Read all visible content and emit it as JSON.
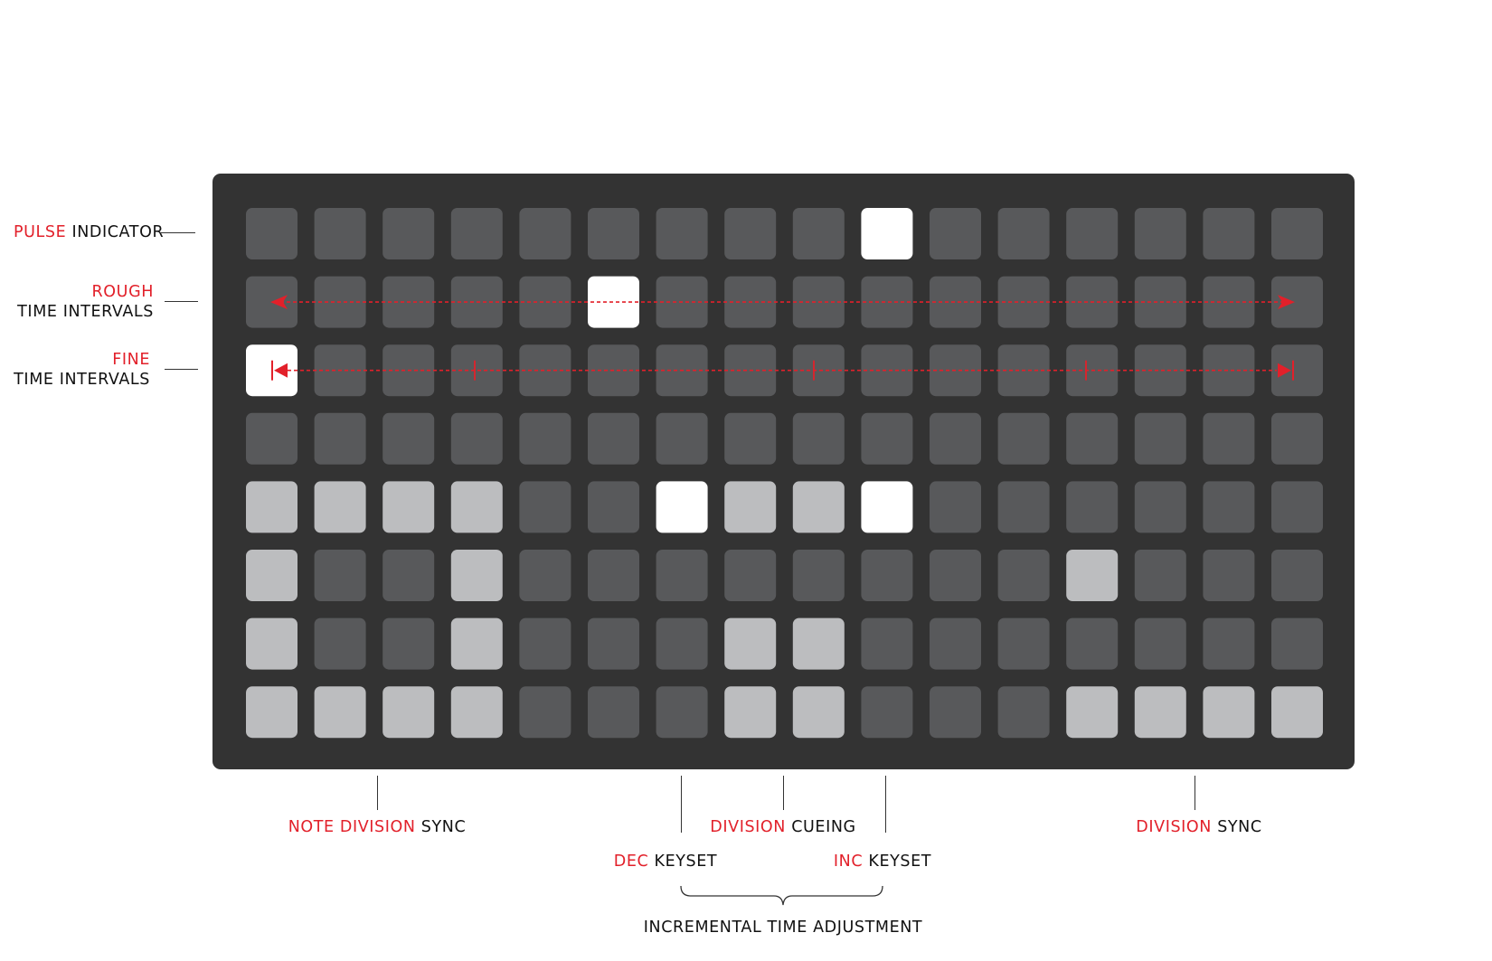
{
  "colors": {
    "panel": "#333333",
    "off": "#58595b",
    "dim": "#bcbdbf",
    "bright": "#ffffff",
    "accent": "#e2202a",
    "text": "#111111"
  },
  "grid": {
    "columns": 16,
    "rows": [
      "0000000002000000",
      "0000020000000000",
      "2000000000000000",
      "0000000000000000",
      "1111002112000000",
      "1001000000001000",
      "1001000110000000",
      "1111000110001111"
    ]
  },
  "labels": {
    "pulse": {
      "accent": "PULSE",
      "rest": "INDICATOR"
    },
    "rough": {
      "line1": "ROUGH",
      "line2": "TIME INTERVALS"
    },
    "fine": {
      "line1": "FINE",
      "line2": "TIME INTERVALS"
    },
    "note_division_sync": {
      "accent": "NOTE DIVISION",
      "rest": "SYNC"
    },
    "division_cueing": {
      "accent": "DIVISION",
      "rest": "CUEING"
    },
    "division_sync": {
      "accent": "DIVISION",
      "rest": "SYNC"
    },
    "dec_keyset": {
      "accent": "DEC",
      "rest": "KEYSET"
    },
    "inc_keyset": {
      "accent": "INC",
      "rest": "KEYSET"
    },
    "incremental": "INCREMENTAL TIME ADJUSTMENT"
  }
}
